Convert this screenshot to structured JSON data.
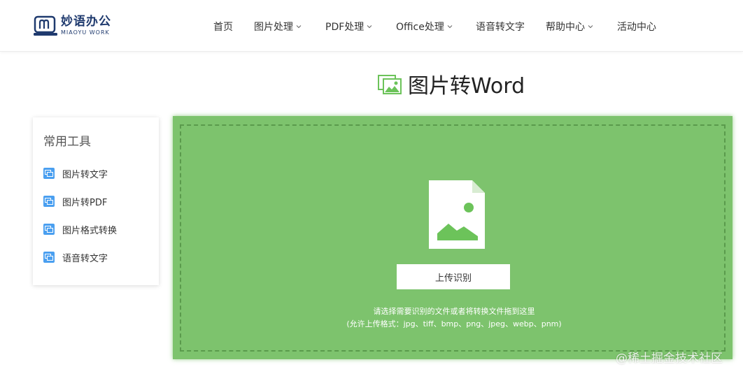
{
  "header": {
    "logo_cn": "妙语办公",
    "logo_en": "MIAOYU WORK",
    "nav": [
      {
        "label": "首页",
        "has_dropdown": false
      },
      {
        "label": "图片处理",
        "has_dropdown": true
      },
      {
        "label": "PDF处理",
        "has_dropdown": true
      },
      {
        "label": "Office处理",
        "has_dropdown": true
      },
      {
        "label": "语音转文字",
        "has_dropdown": false
      },
      {
        "label": "帮助中心",
        "has_dropdown": true
      },
      {
        "label": "活动中心",
        "has_dropdown": false
      }
    ]
  },
  "page": {
    "title": "图片转Word",
    "title_icon": "image-icon"
  },
  "sidebar": {
    "title": "常用工具",
    "items": [
      {
        "label": "图片转文字",
        "icon": "tool-icon"
      },
      {
        "label": "图片转PDF",
        "icon": "tool-icon"
      },
      {
        "label": "图片格式转换",
        "icon": "tool-icon"
      },
      {
        "label": "语音转文字",
        "icon": "tool-icon"
      }
    ]
  },
  "upload": {
    "button_label": "上传识别",
    "hint_line1": "请选择需要识别的文件或者将转换文件拖到这里",
    "hint_line2": "(允许上传格式：jpg、tiff、bmp、png、jpeg、webp、pnm)",
    "icon": "image-file-icon"
  },
  "watermark": "@稀土掘金技术社区",
  "colors": {
    "upload_bg": "#7dc36d",
    "accent_green": "#6cc35a",
    "sidebar_icon": "#4a9ff0",
    "logo": "#1f3a6e"
  }
}
